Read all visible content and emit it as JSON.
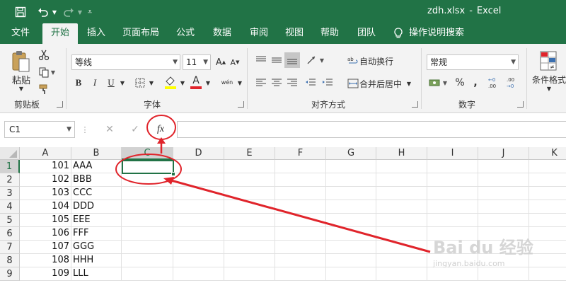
{
  "window": {
    "filename": "zdh.xlsx",
    "separator": "-",
    "app_name": "Excel"
  },
  "tabs": [
    "文件",
    "开始",
    "插入",
    "页面布局",
    "公式",
    "数据",
    "审阅",
    "视图",
    "帮助",
    "团队",
    "操作说明搜索"
  ],
  "active_tab": "开始",
  "ribbon": {
    "clipboard": {
      "paste_label": "粘贴",
      "group_label": "剪贴板"
    },
    "font": {
      "font_name": "等线",
      "font_size": "11",
      "group_label": "字体",
      "bold": "B",
      "italic": "I",
      "underline": "U",
      "font_color_glyph": "A",
      "phonetic_glyph": "wén"
    },
    "alignment": {
      "wrap_text": "自动换行",
      "merge_center": "合并后居中",
      "group_label": "对齐方式"
    },
    "number": {
      "format": "常规",
      "percent": "%",
      "comma": ",",
      "group_label": "数字"
    },
    "styles": {
      "conditional_format": "条件格式"
    }
  },
  "formula_bar": {
    "name_box": "C1",
    "cancel_glyph": "✕",
    "enter_glyph": "✓",
    "fx_label": "fx",
    "content": ""
  },
  "sheet": {
    "columns": [
      "A",
      "B",
      "C",
      "D",
      "E",
      "F",
      "G",
      "H",
      "I",
      "J",
      "K"
    ],
    "selected_column": "C",
    "selected_row": 1,
    "rows": [
      {
        "num": "1",
        "a": "101",
        "b": "AAA"
      },
      {
        "num": "2",
        "a": "102",
        "b": "BBB"
      },
      {
        "num": "3",
        "a": "103",
        "b": "CCC"
      },
      {
        "num": "4",
        "a": "104",
        "b": "DDD"
      },
      {
        "num": "5",
        "a": "105",
        "b": "EEE"
      },
      {
        "num": "6",
        "a": "106",
        "b": "FFF"
      },
      {
        "num": "7",
        "a": "107",
        "b": "GGG"
      },
      {
        "num": "8",
        "a": "108",
        "b": "HHH"
      },
      {
        "num": "9",
        "a": "109",
        "b": "LLL"
      }
    ]
  },
  "colors": {
    "excel_green": "#217346",
    "annotation_red": "#e0242b"
  },
  "watermark": {
    "brand": "Bai du 经验",
    "url": "jingyan.baidu.com"
  }
}
